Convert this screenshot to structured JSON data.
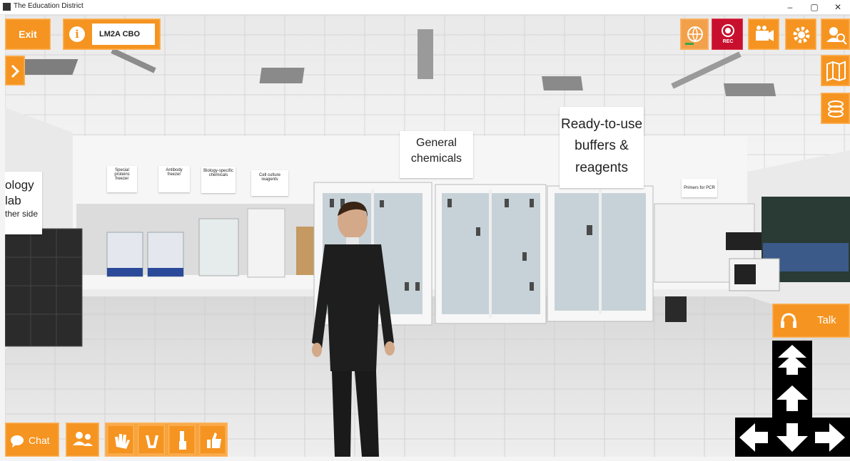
{
  "window": {
    "title": "The Education District",
    "minimize": "–",
    "restore": "▢",
    "close": "✕"
  },
  "topbar": {
    "exit_label": "Exit",
    "info_icon": "info-icon",
    "session_code": "LM2A CBO",
    "rec_label": "REC",
    "icons": [
      "network-icon",
      "record-icon",
      "camera-icon",
      "settings-icon",
      "users-icon"
    ]
  },
  "right_tools": [
    "map-icon",
    "layers-icon"
  ],
  "talk": {
    "label": "Talk",
    "icon": "headset-icon"
  },
  "chat": {
    "label": "Chat",
    "icon": "speech-bubble-icon"
  },
  "gestures": [
    "people-icon",
    "wave-icon",
    "hands-up-icon",
    "raise-hand-icon",
    "thumbs-up-icon"
  ],
  "movement": [
    "double-up-arrow",
    "up-arrow",
    "left-arrow",
    "down-arrow",
    "right-arrow"
  ],
  "scene_signs": {
    "biology_lab_1": "ology lab",
    "biology_lab_2": "ther side",
    "special_proteins_1": "Special proteins",
    "special_proteins_2": "freezer",
    "antibody_1": "Antibody",
    "antibody_2": "freezer",
    "biology_chem_1": "Biology-specific",
    "biology_chem_2": "chemicals",
    "cell_culture_1": "Cell culture",
    "cell_culture_2": "reagents",
    "general_1": "General",
    "general_2": "chemicals",
    "ready_1": "Ready-to-use",
    "ready_2": "buffers & reagents",
    "primers": "Primers for PCR"
  },
  "colors": {
    "accent": "#f59420",
    "rec": "#c8102e",
    "dpad": "#000000"
  }
}
